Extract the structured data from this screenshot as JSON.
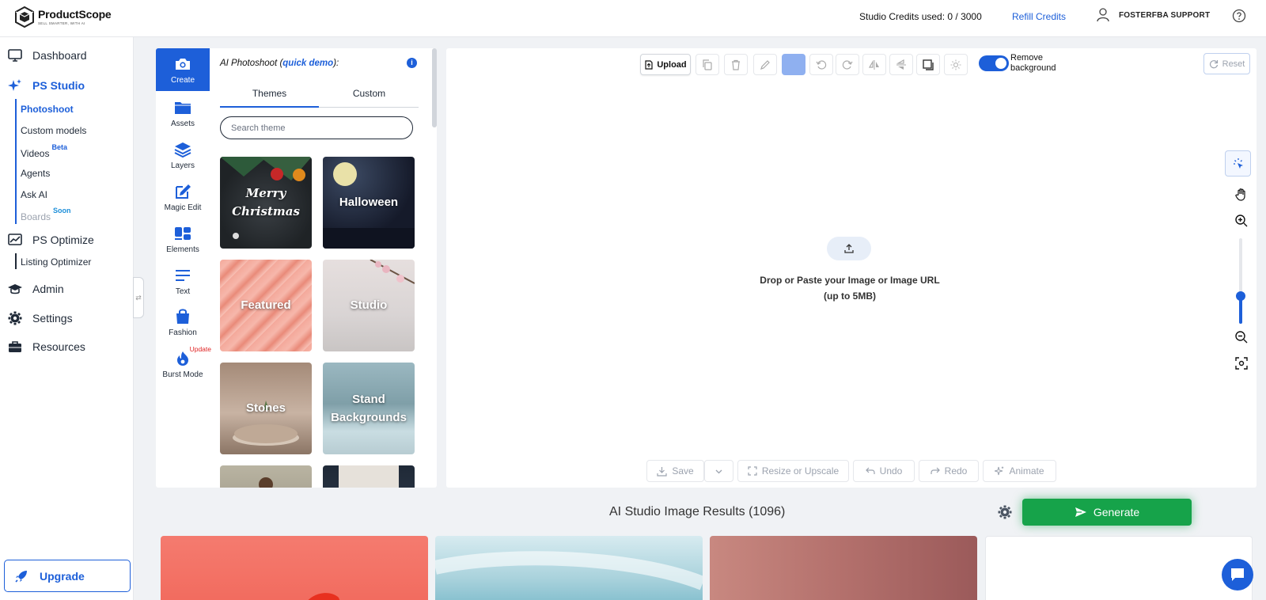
{
  "header": {
    "logo_name": "ProductScope",
    "logo_tagline": "SELL SMARTER, WITH AI",
    "credits": "Studio Credits used: 0 / 3000",
    "refill": "Refill Credits",
    "user": "FOSTERFBA SUPPORT"
  },
  "sidebar": {
    "items": [
      {
        "label": "Dashboard",
        "icon": "monitor-icon"
      },
      {
        "label": "PS Studio",
        "icon": "sparkles-icon",
        "active": true
      },
      {
        "label": "PS Optimize",
        "icon": "chart-icon"
      },
      {
        "label": "Admin",
        "icon": "graduation-cap-icon"
      },
      {
        "label": "Settings",
        "icon": "gear-icon"
      },
      {
        "label": "Resources",
        "icon": "briefcase-icon"
      }
    ],
    "studio_sub": [
      {
        "label": "Photoshoot",
        "active": true
      },
      {
        "label": "Custom models"
      },
      {
        "label": "Videos",
        "badge": "Beta"
      },
      {
        "label": "Agents"
      },
      {
        "label": "Ask AI"
      },
      {
        "label": "Boards",
        "badge": "Soon"
      }
    ],
    "optimize_sub": [
      {
        "label": "Listing Optimizer"
      }
    ],
    "upgrade": "Upgrade"
  },
  "tools": [
    {
      "label": "Create"
    },
    {
      "label": "Assets"
    },
    {
      "label": "Layers"
    },
    {
      "label": "Magic Edit"
    },
    {
      "label": "Elements"
    },
    {
      "label": "Text"
    },
    {
      "label": "Fashion"
    },
    {
      "label": "Burst Mode",
      "badge": "Update"
    }
  ],
  "panel": {
    "title_prefix": "AI Photoshoot (",
    "title_link": "quick demo",
    "title_suffix": "):",
    "tabs": [
      "Themes",
      "Custom"
    ],
    "search_placeholder": "Search theme",
    "themes": [
      "Merry Christmas",
      "Halloween",
      "Featured",
      "Studio",
      "Stones",
      "Stand Backgrounds"
    ]
  },
  "canvas": {
    "upload": "Upload",
    "remove_bg": "Remove background",
    "remove_bg_on": true,
    "reset": "Reset",
    "drop_line1": "Drop or Paste your Image or Image URL",
    "drop_line2": "(up to 5MB)",
    "zoom_level": 0.32,
    "actions": [
      "Save",
      "Resize or Upscale",
      "Undo",
      "Redo",
      "Animate"
    ]
  },
  "results": {
    "title": "AI Studio Image Results (1096)",
    "generate": "Generate"
  },
  "colors": {
    "accent": "#1d5fd9",
    "generate": "#16a34a"
  }
}
